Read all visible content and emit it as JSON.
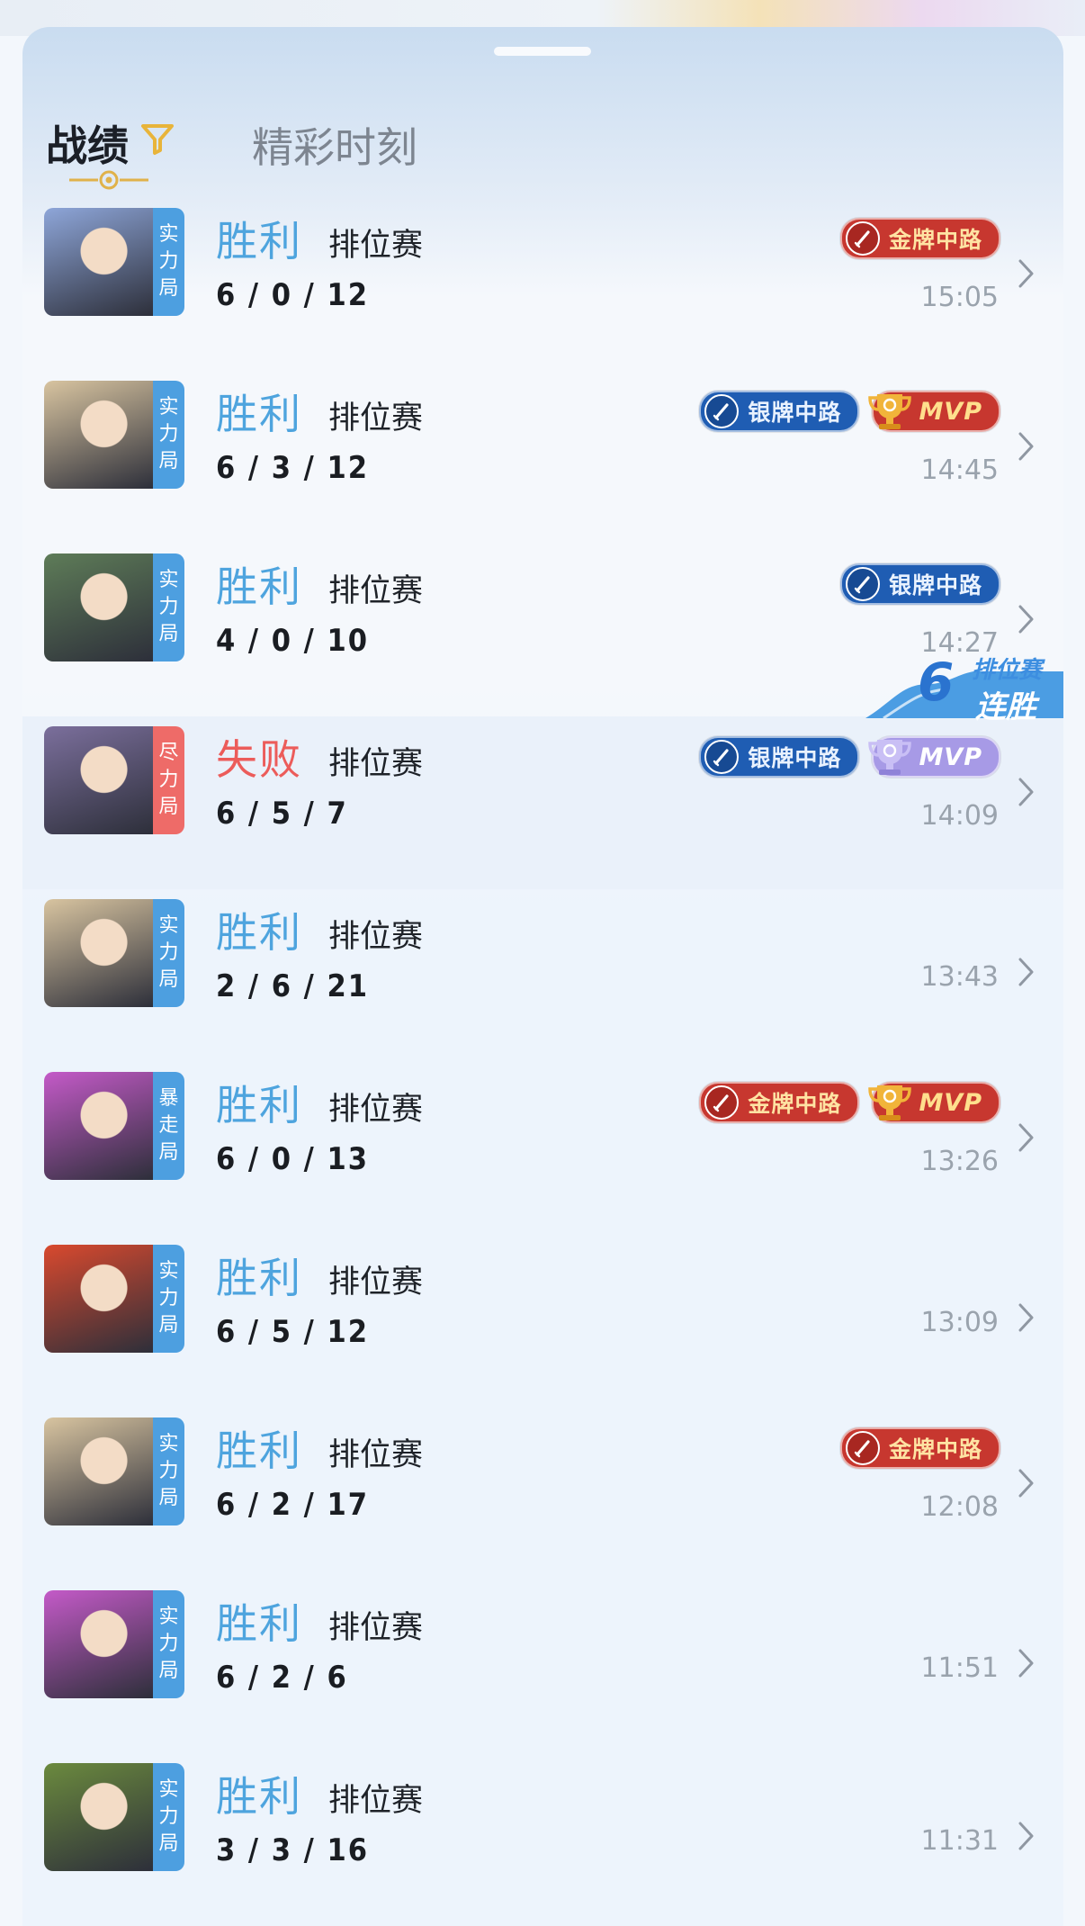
{
  "tabs": {
    "record": "战绩",
    "highlights": "精彩时刻"
  },
  "matches": [
    {
      "result": "胜利",
      "loss": false,
      "type": "排位赛",
      "kda": "6 / 0 / 12",
      "time": "15:05",
      "mode": [
        "实",
        "力",
        "局"
      ],
      "badges": [
        "gold"
      ],
      "bgColor": "#8ea6d9"
    },
    {
      "result": "胜利",
      "loss": false,
      "type": "排位赛",
      "kda": "6 / 3 / 12",
      "time": "14:45",
      "mode": [
        "实",
        "力",
        "局"
      ],
      "badges": [
        "silver",
        "mvp-red"
      ],
      "bgColor": "#d8c4a0"
    },
    {
      "result": "胜利",
      "loss": false,
      "type": "排位赛",
      "kda": "4 / 0 / 10",
      "time": "14:27",
      "mode": [
        "实",
        "力",
        "局"
      ],
      "badges": [
        "silver"
      ],
      "bgColor": "#5e7c58"
    },
    {
      "result": "失败",
      "loss": true,
      "type": "排位赛",
      "kda": "6 / 5 / 7",
      "time": "14:09",
      "mode": [
        "尽",
        "力",
        "局"
      ],
      "badges": [
        "silver",
        "mvp-purple"
      ],
      "bgColor": "#7b6f9c"
    },
    {
      "result": "胜利",
      "loss": false,
      "type": "排位赛",
      "kda": "2 / 6 / 21",
      "time": "13:43",
      "mode": [
        "实",
        "力",
        "局"
      ],
      "badges": [],
      "bgColor": "#d8c4a0"
    },
    {
      "result": "胜利",
      "loss": false,
      "type": "排位赛",
      "kda": "6 / 0 / 13",
      "time": "13:26",
      "mode": [
        "暴",
        "走",
        "局"
      ],
      "badges": [
        "gold",
        "mvp-red"
      ],
      "bgColor": "#c45ac8"
    },
    {
      "result": "胜利",
      "loss": false,
      "type": "排位赛",
      "kda": "6 / 5 / 12",
      "time": "13:09",
      "mode": [
        "实",
        "力",
        "局"
      ],
      "badges": [],
      "bgColor": "#d9492e"
    },
    {
      "result": "胜利",
      "loss": false,
      "type": "排位赛",
      "kda": "6 / 2 / 17",
      "time": "12:08",
      "mode": [
        "实",
        "力",
        "局"
      ],
      "badges": [
        "gold"
      ],
      "bgColor": "#d8c4a0"
    },
    {
      "result": "胜利",
      "loss": false,
      "type": "排位赛",
      "kda": "6 / 2 / 6",
      "time": "11:51",
      "mode": [
        "实",
        "力",
        "局"
      ],
      "badges": [],
      "bgColor": "#c45ac8"
    },
    {
      "result": "胜利",
      "loss": false,
      "type": "排位赛",
      "kda": "3 / 3 / 16",
      "time": "11:31",
      "mode": [
        "实",
        "力",
        "局"
      ],
      "badges": [],
      "bgColor": "#6b8a3e"
    }
  ],
  "badge_labels": {
    "gold": "金牌中路",
    "silver": "银牌中路",
    "mvp": "MVP"
  },
  "streak": {
    "count": "6",
    "line1": "排位赛",
    "line2": "连胜"
  },
  "colors": {
    "win": "#4ea4de",
    "loss": "#ec5c5a",
    "gold_badge": "#c7372f",
    "silver_badge": "#1f5db3",
    "mvp_purple": "#a79ae6"
  },
  "icons": {
    "filter": "filter-icon",
    "chevron": "chevron-right-icon",
    "trophy": "trophy-icon",
    "sword": "sword-icon"
  }
}
